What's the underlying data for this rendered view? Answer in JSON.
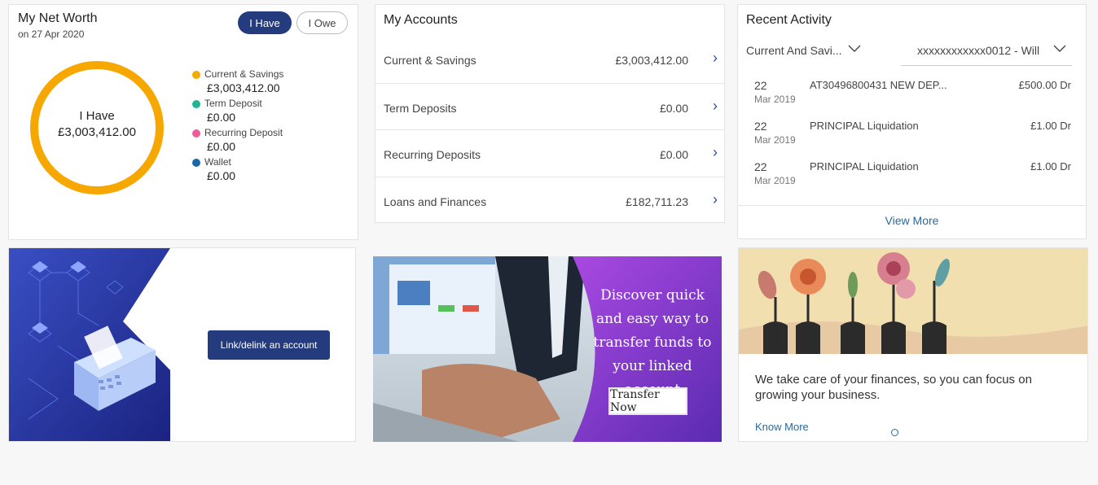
{
  "networth": {
    "title": "My Net Worth",
    "date": "on 27 Apr 2020",
    "toggle_have": "I Have",
    "toggle_owe": "I Owe",
    "donut_label": "I Have",
    "donut_amount": "£3,003,412.00",
    "donut_color": "#f7a800",
    "legend": [
      {
        "label": "Current & Savings",
        "value": "£3,003,412.00",
        "color": "#f7a800"
      },
      {
        "label": "Term Deposit",
        "value": "£0.00",
        "color": "#1fb592"
      },
      {
        "label": "Recurring Deposit",
        "value": "£0.00",
        "color": "#ec5b9a"
      },
      {
        "label": "Wallet",
        "value": "£0.00",
        "color": "#1a67a8"
      }
    ]
  },
  "accounts": {
    "title": "My Accounts",
    "rows": [
      {
        "label": "Current & Savings",
        "amount": "£3,003,412.00"
      },
      {
        "label": "Term Deposits",
        "amount": "£0.00"
      },
      {
        "label": "Recurring Deposits",
        "amount": "£0.00"
      },
      {
        "label": "Loans and Finances",
        "amount": "£182,711.23"
      }
    ]
  },
  "activity": {
    "title": "Recent Activity",
    "account_type": "Current And Savi...",
    "account_number": "xxxxxxxxxxxx0012 - Will",
    "transactions": [
      {
        "day": "22",
        "month": "Mar 2019",
        "description": "AT30496800431 NEW DEP...",
        "amount": "£500.00 Dr"
      },
      {
        "day": "22",
        "month": "Mar 2019",
        "description": "PRINCIPAL Liquidation",
        "amount": "£1.00 Dr"
      },
      {
        "day": "22",
        "month": "Mar 2019",
        "description": "PRINCIPAL Liquidation",
        "amount": "£1.00 Dr"
      }
    ],
    "view_more": "View More"
  },
  "banners": {
    "link_button": "Link/delink an account",
    "transfer_text": "Discover quick and easy way to transfer funds to your linked account",
    "transfer_button": "Transfer Now",
    "promo_text": "We take care of your finances, so you can focus on growing your business.",
    "promo_link": "Know More"
  },
  "colors": {
    "primary": "#243b7e",
    "link": "#2c6a99",
    "background": "#f7f7f7"
  }
}
